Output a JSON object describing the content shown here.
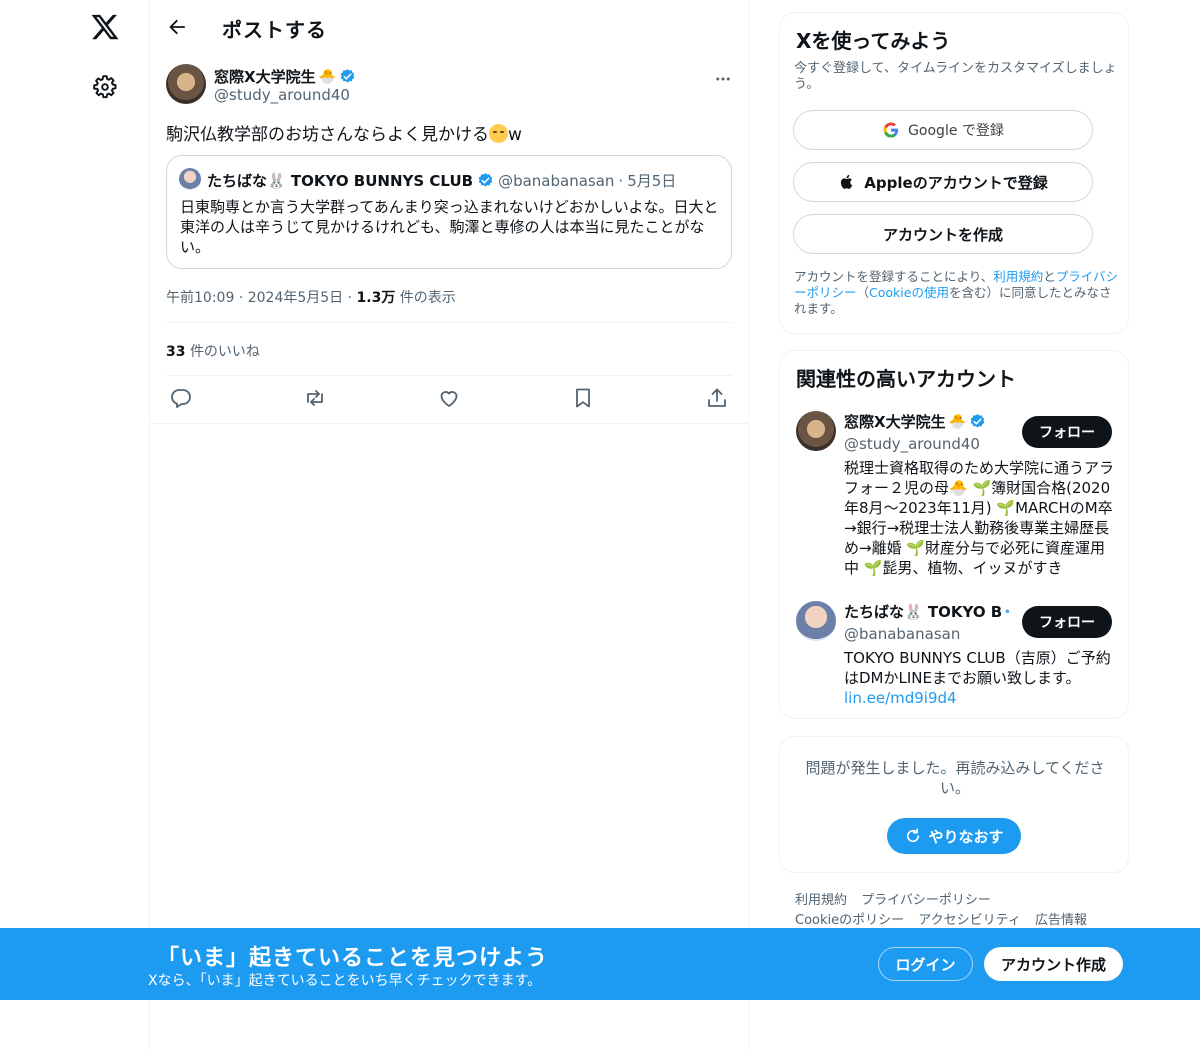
{
  "nav": {
    "logo_icon": "x-logo-icon",
    "settings_icon": "gear-icon"
  },
  "header": {
    "title": "ポストする"
  },
  "post": {
    "author_name": "窓際X大学院生",
    "author_emoji": "🐣",
    "handle": "@study_around40",
    "text": "駒沢仏教学部のお坊さんならよく見かける",
    "text_suffix": "w",
    "quote": {
      "name": "たちばな🐰 TOKYO BUNNYS CLUB",
      "handle": "@banabanasan",
      "separator": "·",
      "date": "5月5日",
      "text": "日東駒専とか言う大学群ってあんまり突っ込まれないけどおかしいよな。日大と東洋の人は辛うじて見かけるけれども、駒澤と専修の人は本当に見たことがない。"
    },
    "time": "午前10:09",
    "date": "2024年5月5日",
    "views_count": "1.3万",
    "views_label": "件の表示",
    "likes_count": "33",
    "likes_label": "件のいいね",
    "dot": "·"
  },
  "signup": {
    "title": "Xを使ってみよう",
    "subtitle": "今すぐ登録して、タイムラインをカスタマイズしましょう。",
    "google_label": "Google で登録",
    "apple_label": "Appleのアカウントで登録",
    "create_label": "アカウントを作成",
    "legal_prefix": "アカウントを登録することにより、",
    "legal_terms": "利用規約",
    "legal_and": "と",
    "legal_privacy": "プライバシーポリシー",
    "legal_open": "（",
    "legal_cookie": "Cookieの使用",
    "legal_suffix": "を含む）に同意したとみなされます。"
  },
  "recommend": {
    "title": "関連性の高いアカウント",
    "accounts": [
      {
        "name": "窓際X大学院生",
        "emoji": "🐣",
        "handle": "@study_around40",
        "bio": "税理士資格取得のため大学院に通うアラフォー２児の母🐣 🌱簿財国合格(2020年8月〜2023年11月) 🌱MARCHのM卒→銀行→税理士法人勤務後専業主婦歴長め→離婚 🌱財産分与で必死に資産運用中 🌱髭男、植物、イッヌがすき",
        "follow_label": "フォロー"
      },
      {
        "name": "たちばな🐰 TOKYO B",
        "handle": "@banabanasan",
        "bio": "TOKYO BUNNYS CLUB（吉原）ご予約はDMかLINEまでお願い致します。",
        "link": "lin.ee/md9i9d4",
        "follow_label": "フォロー"
      }
    ]
  },
  "error": {
    "text": "問題が発生しました。再読み込みしてください。",
    "retry_label": "やりなおす"
  },
  "footer": {
    "links": [
      "利用規約",
      "プライバシーポリシー",
      "Cookieのポリシー",
      "アクセシビリティ",
      "広告情報"
    ]
  },
  "banner": {
    "title": "「いま」起きていることを見つけよう",
    "subtitle": "Xなら、「いま」起きていることをいち早くチェックできます。",
    "login_label": "ログイン",
    "create_label": "アカウント作成"
  },
  "colors": {
    "accent": "#1d9bf0",
    "text": "#0f1419",
    "muted": "#536471",
    "border": "#eff3f4"
  }
}
